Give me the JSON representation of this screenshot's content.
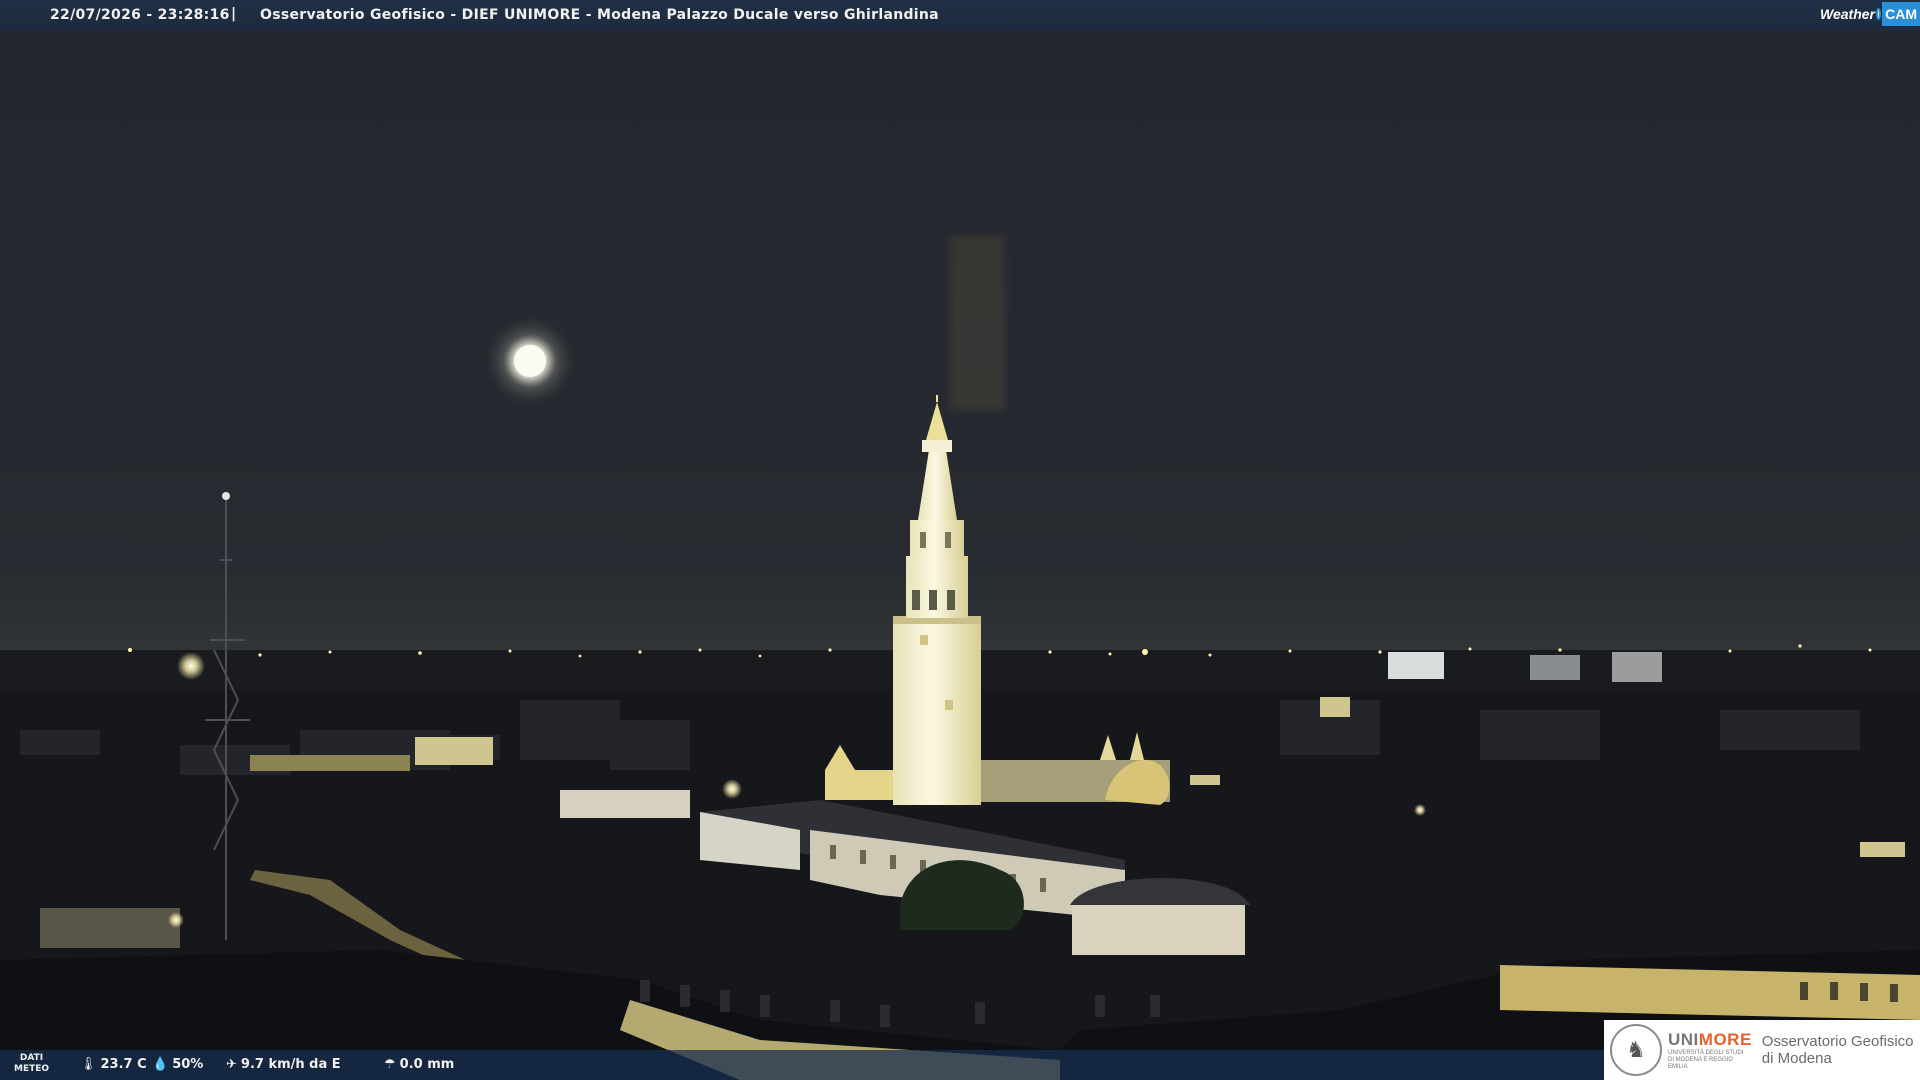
{
  "header": {
    "timestamp": "22/07/2026 - 23:28:16",
    "separator": "|",
    "title": "Osservatorio Geofisico - DIEF UNIMORE - Modena Palazzo Ducale verso Ghirlandina"
  },
  "logo": {
    "weather": "Weather",
    "cam": "CAM"
  },
  "weather_bar": {
    "label_line1": "DATI",
    "label_line2": "METEO",
    "temperature": "23.7 C",
    "humidity": "50%",
    "wind": "9.7 km/h da E",
    "rain": "0.0 mm",
    "icons": {
      "temperature": "thermometer-icon",
      "humidity": "droplet-icon",
      "wind": "wind-icon",
      "rain": "umbrella-icon"
    }
  },
  "institution": {
    "name_prefix": "UNI",
    "name_suffix": "MORE",
    "subtitle": "UNIVERSITÀ DEGLI STUDI DI MODENA E REGGIO EMILIA",
    "observatory_line1": "Osservatorio Geofisico",
    "observatory_line2": "di Modena"
  },
  "colors": {
    "sky": "#262a30",
    "lights": "#ffe79a",
    "tower": "#f3f0d2",
    "bar": "#1c2b3f",
    "accent": "#e5622a",
    "cam_blue": "#2b8fd8"
  }
}
